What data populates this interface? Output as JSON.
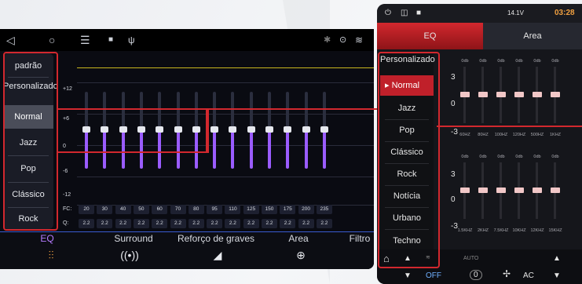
{
  "left": {
    "presets": [
      "padrão",
      "Personalizado",
      "Normal",
      "Jazz",
      "Pop",
      "Clássico",
      "Rock"
    ],
    "active_preset": "Normal",
    "gain_labels": [
      "+12",
      "+6",
      "0",
      "-6",
      "-12"
    ],
    "fc_label": "FC:",
    "q_label": "Q:",
    "fc_values": [
      "20",
      "30",
      "40",
      "50",
      "60",
      "70",
      "80",
      "95",
      "110",
      "125",
      "150",
      "175",
      "200",
      "235"
    ],
    "q_values": [
      "2.2",
      "2.2",
      "2.2",
      "2.2",
      "2.2",
      "2.2",
      "2.2",
      "2.2",
      "2.2",
      "2.2",
      "2.2",
      "2.2",
      "2.2",
      "2.2"
    ],
    "tabs": [
      "EQ",
      "Surround",
      "Reforço de graves",
      "Area",
      "Filtro"
    ],
    "active_tab": "EQ"
  },
  "right": {
    "tabs": [
      "EQ",
      "Area"
    ],
    "status_time": "03:28",
    "status_voltage": "14.1V",
    "presets": [
      "Personalizado",
      "Normal",
      "Jazz",
      "Pop",
      "Clássico",
      "Rock",
      "Notícia",
      "Urbano",
      "Techno"
    ],
    "active_preset": "Normal",
    "row1_db": [
      "0db",
      "0db",
      "0db",
      "0db",
      "0db",
      "0db"
    ],
    "row1_freq": [
      "60HZ",
      "80HZ",
      "100HZ",
      "120HZ",
      "500HZ",
      "1KHZ"
    ],
    "row2_db": [
      "0db",
      "0db",
      "0db",
      "0db",
      "0db",
      "0db"
    ],
    "row2_freq": [
      "1.5KHZ",
      "2KHZ",
      "7.5KHZ",
      "10KHZ",
      "12KHZ",
      "15KHZ"
    ],
    "scale": [
      "3",
      "0",
      "-3"
    ],
    "bottom": {
      "off": "OFF",
      "auto": "AUTO",
      "temp": "0",
      "ac": "AC"
    }
  },
  "colors": {
    "accent_red": "#d2282e",
    "purple": "#9a5cff",
    "yellow": "#c9b61e"
  }
}
